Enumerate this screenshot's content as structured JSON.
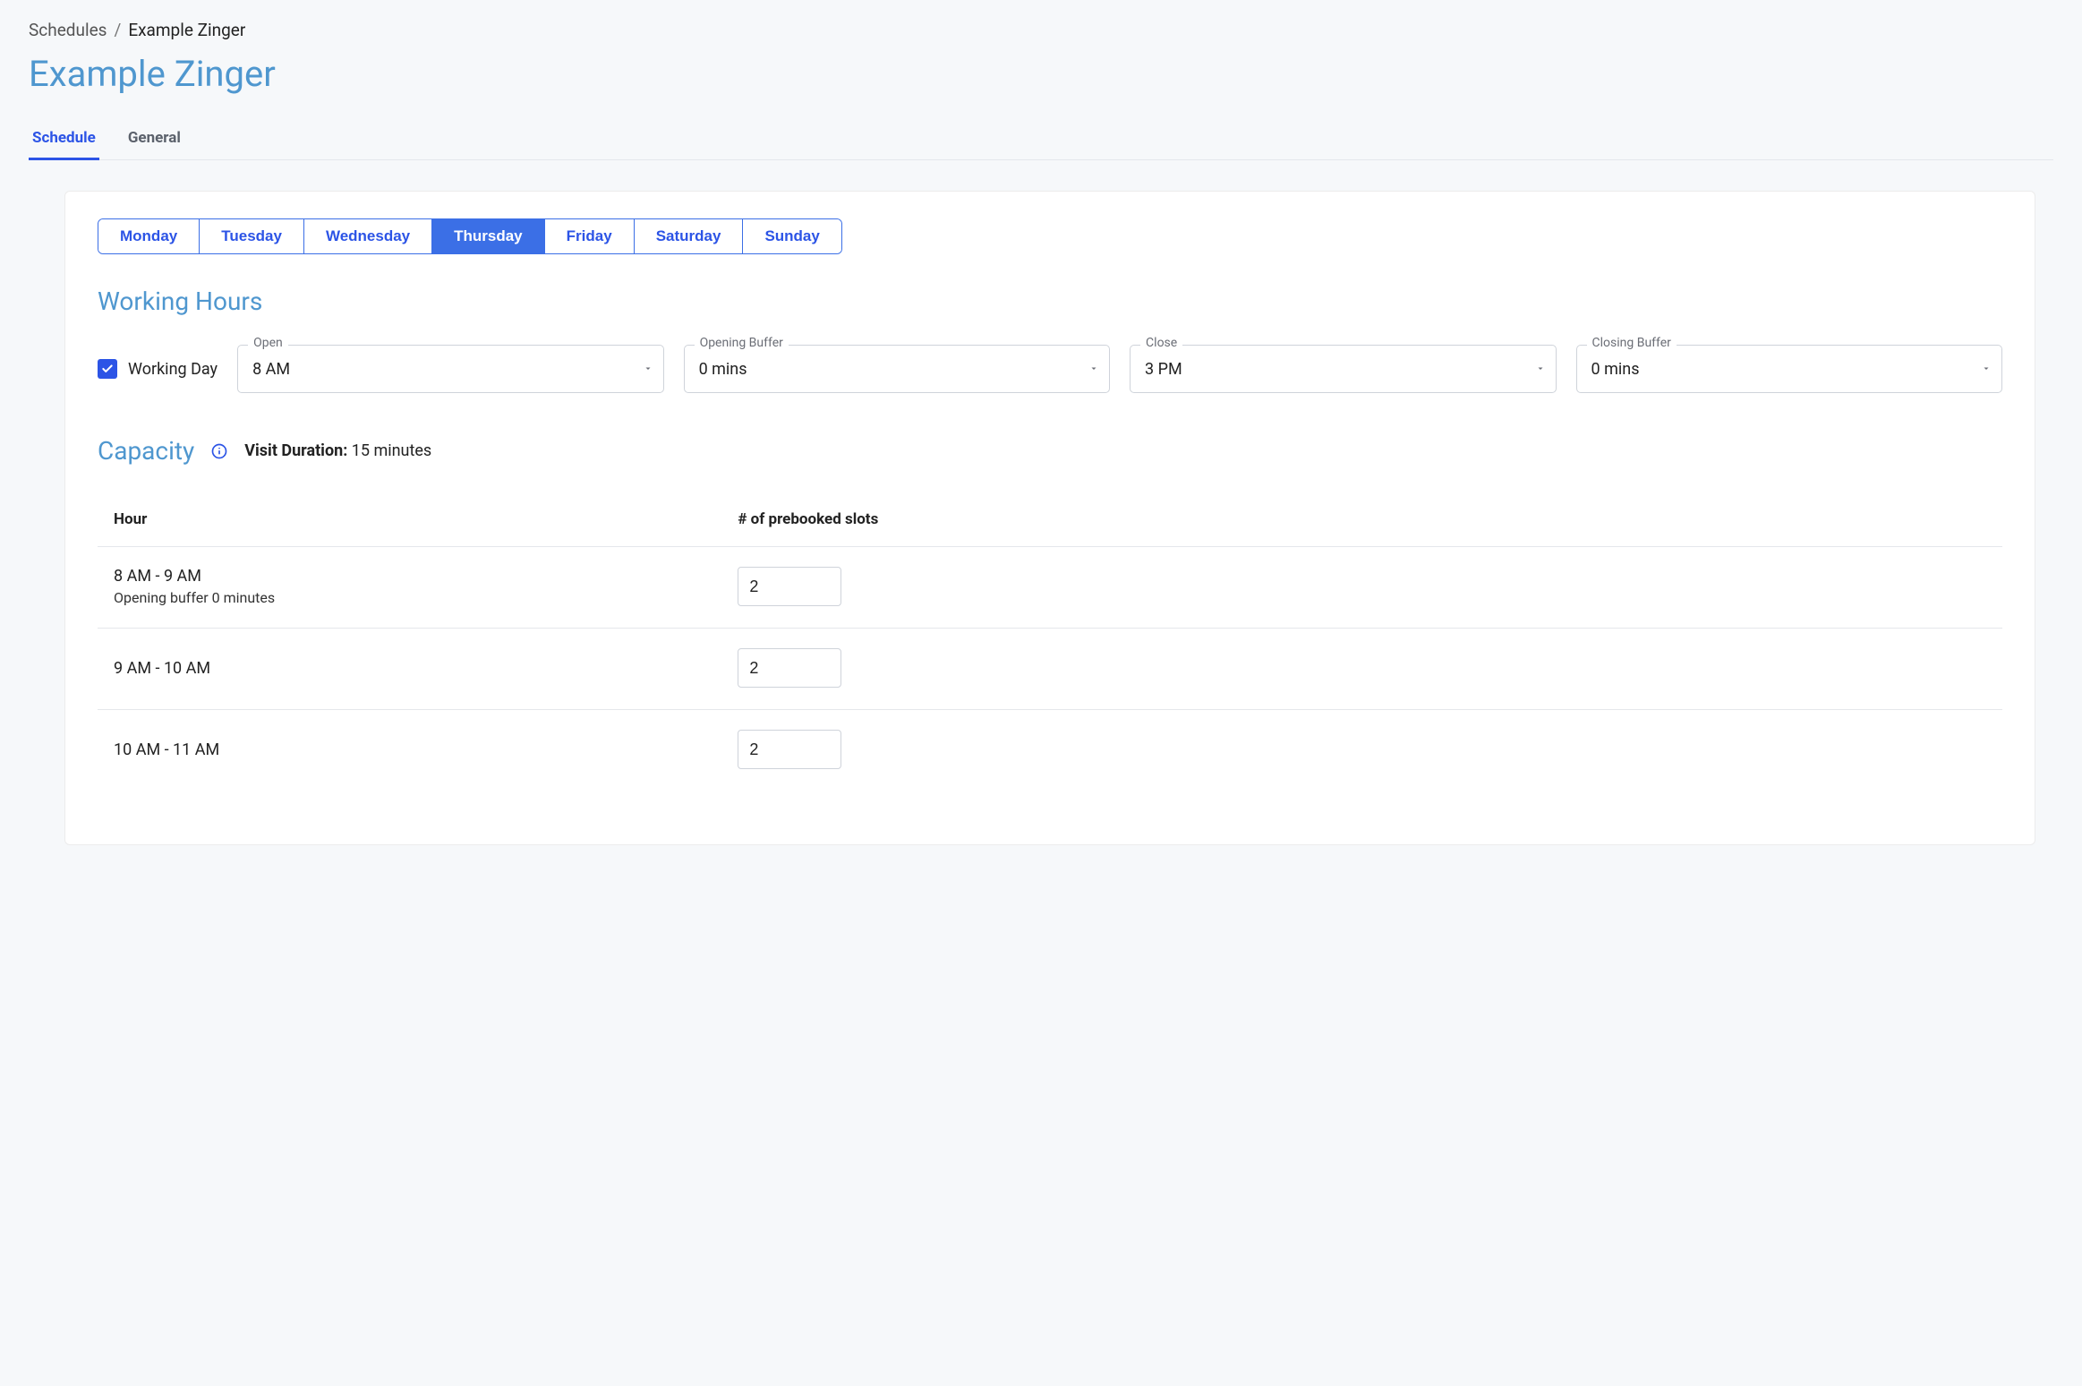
{
  "breadcrumb": {
    "root": "Schedules",
    "separator": "/",
    "current": "Example Zinger"
  },
  "title": "Example Zinger",
  "tabs": {
    "schedule": "Schedule",
    "general": "General",
    "active": "schedule"
  },
  "days": {
    "items": [
      "Monday",
      "Tuesday",
      "Wednesday",
      "Thursday",
      "Friday",
      "Saturday",
      "Sunday"
    ],
    "active_index": 3
  },
  "working_hours": {
    "heading": "Working Hours",
    "checkbox_label": "Working Day",
    "checked": true,
    "open": {
      "label": "Open",
      "value": "8 AM"
    },
    "opening_buffer": {
      "label": "Opening Buffer",
      "value": "0 mins"
    },
    "close": {
      "label": "Close",
      "value": "3 PM"
    },
    "closing_buffer": {
      "label": "Closing Buffer",
      "value": "0 mins"
    }
  },
  "capacity": {
    "heading": "Capacity",
    "visit_duration_label": "Visit Duration:",
    "visit_duration_value": "15 minutes",
    "columns": {
      "hour": "Hour",
      "slots": "# of prebooked slots"
    },
    "rows": [
      {
        "hour": "8 AM - 9 AM",
        "sub": "Opening buffer 0 minutes",
        "slots": "2"
      },
      {
        "hour": "9 AM - 10 AM",
        "sub": "",
        "slots": "2"
      },
      {
        "hour": "10 AM - 11 AM",
        "sub": "",
        "slots": "2"
      }
    ]
  }
}
